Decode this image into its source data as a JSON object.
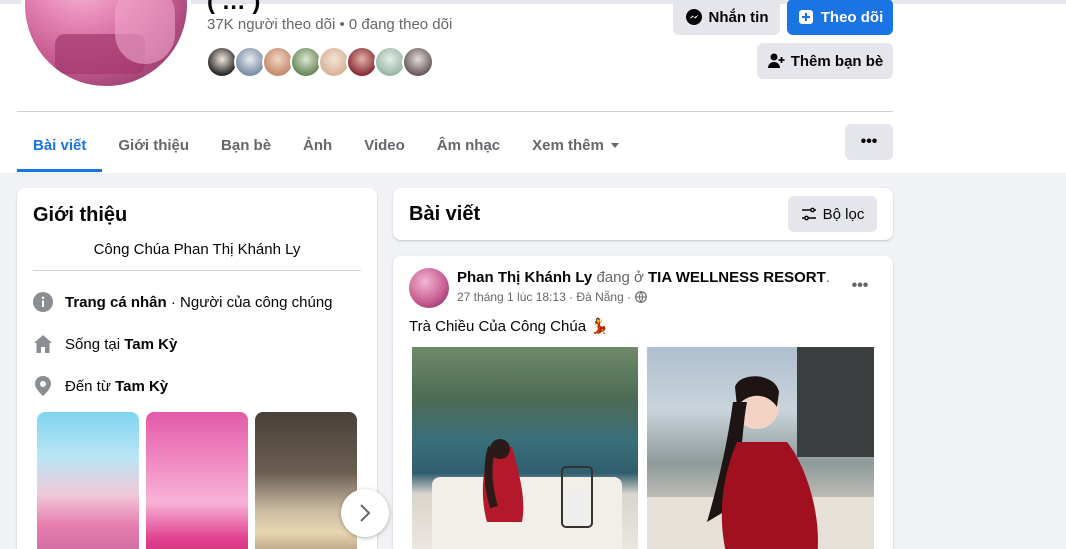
{
  "profile": {
    "name_partial": "( … )",
    "stats": "37K người theo dõi • 0 đang theo dõi",
    "friend_avatar_colors": [
      "#3b3b3b",
      "#7c8ea8",
      "#c48b6e",
      "#6a8a5a",
      "#d8b49a",
      "#8b2f3a",
      "#9ab8a8",
      "#6b5b5b"
    ]
  },
  "actions": {
    "message": "Nhắn tin",
    "follow": "Theo dõi",
    "add_friend": "Thêm bạn bè"
  },
  "tabs": [
    {
      "label": "Bài viết"
    },
    {
      "label": "Giới thiệu"
    },
    {
      "label": "Bạn bè"
    },
    {
      "label": "Ảnh"
    },
    {
      "label": "Video"
    },
    {
      "label": "Âm nhạc"
    },
    {
      "label": "Xem thêm"
    }
  ],
  "more_label": "•••",
  "intro": {
    "title": "Giới thiệu",
    "bio": "Công Chúa Phan Thị Khánh Ly",
    "page_prefix": "Trang cá nhân",
    "page_suffix": " · Người của công chúng",
    "lives_prefix": "Sống tại ",
    "lives_place": "Tam Kỳ",
    "from_prefix": "Đến từ ",
    "from_place": "Tam Kỳ"
  },
  "posts": {
    "title": "Bài viết",
    "filter": "Bộ lọc"
  },
  "post": {
    "author": "Phan Thị Khánh Ly",
    "at_text": " đang ở ",
    "place": "TIA WELLNESS RESORT",
    "period": ".",
    "meta": "27 tháng 1 lúc 18:13 · Đà Nẵng ·",
    "text": "Trà Chiều Của Công Chúa 💃",
    "dots": "•••"
  },
  "colors": {
    "accent": "#1b74e4",
    "button_gray": "#e4e6eb",
    "secondary_text": "#65676b",
    "background": "#f0f2f5"
  }
}
